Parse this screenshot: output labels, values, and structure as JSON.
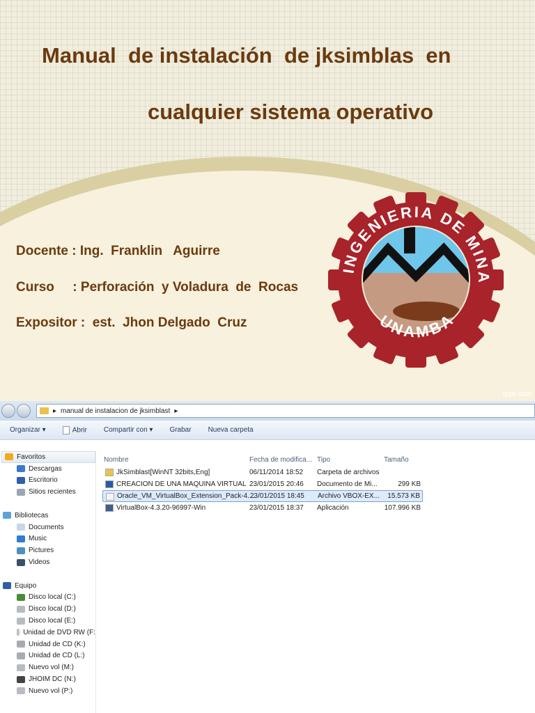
{
  "slide": {
    "title_line1": "Manual  de instalación  de jksimblas  en",
    "title_line2": "cualquier sistema operativo",
    "docente": "Docente : Ing.  Franklin   Aguirre",
    "curso": "Curso     : Perforación  y Voladura  de  Rocas",
    "expositor": "Expositor :  est.  Jhon Delgado  Cruz",
    "logo_text_top": "INGENIERIA DE MINAS",
    "logo_text_bottom": "UNAMBA",
    "watermark": "fppt.com"
  },
  "explorer": {
    "breadcrumb": "manual de instalacion de  jksimblast",
    "toolbar": {
      "organize": "Organizar ▾",
      "open": "Abrir",
      "share": "Compartir con ▾",
      "burn": "Grabar",
      "new_folder": "Nueva carpeta"
    },
    "sidebar": [
      {
        "label": "Favoritos",
        "group": true,
        "icon": "star-icon",
        "color": "#f2a91e"
      },
      {
        "label": "Descargas",
        "icon": "downloads-icon",
        "color": "#3a7ad0"
      },
      {
        "label": "Escritorio",
        "icon": "desktop-icon",
        "color": "#2f5fa8"
      },
      {
        "label": "Sitios recientes",
        "icon": "recent-icon",
        "color": "#9aa6b4"
      },
      {
        "label": "",
        "spacer": true
      },
      {
        "label": "Bibliotecas",
        "group": true,
        "icon": "libraries-icon",
        "color": "#5ba3d9"
      },
      {
        "label": "Documents",
        "icon": "documents-icon",
        "color": "#c9d6e6"
      },
      {
        "label": "Music",
        "icon": "music-icon",
        "color": "#2f7bd6"
      },
      {
        "label": "Pictures",
        "icon": "pictures-icon",
        "color": "#4e8fbf"
      },
      {
        "label": "Videos",
        "icon": "videos-icon",
        "color": "#3a4f6a"
      },
      {
        "label": "",
        "spacer": true
      },
      {
        "label": "Equipo",
        "group": true,
        "icon": "computer-icon",
        "color": "#2d5fa3"
      },
      {
        "label": "Disco local (C:)",
        "icon": "drive-c-icon",
        "color": "#4a8a3a"
      },
      {
        "label": "Disco local (D:)",
        "icon": "drive-icon",
        "color": "#b8bcc2"
      },
      {
        "label": "Disco local (E:)",
        "icon": "drive-icon",
        "color": "#b8bcc2"
      },
      {
        "label": "Unidad de DVD RW (F:",
        "icon": "dvd-icon",
        "color": "#c0c0c0"
      },
      {
        "label": "Unidad de CD (K:)",
        "icon": "cd-icon",
        "color": "#a8acb2"
      },
      {
        "label": "Unidad de CD (L:)",
        "icon": "cd-icon",
        "color": "#a8acb2"
      },
      {
        "label": "Nuevo vol (M:)",
        "icon": "drive-icon",
        "color": "#b8bcc2"
      },
      {
        "label": "JHOIM DC (N:)",
        "icon": "usb-drive-icon",
        "color": "#444"
      },
      {
        "label": "Nuevo vol (P:)",
        "icon": "drive-icon",
        "color": "#b8bcc2"
      }
    ],
    "columns": [
      "Nombre",
      "Fecha de modifica...",
      "Tipo",
      "Tamaño"
    ],
    "files": [
      {
        "name": "JkSimblast[WinNT 32bits,Eng]",
        "date": "06/11/2014 18:52",
        "type": "Carpeta de archivos",
        "size": "",
        "icon": "folder-icon",
        "color": "#e8c350"
      },
      {
        "name": "CREACION DE UNA MAQUINA VIRTUAL",
        "date": "23/01/2015 20:46",
        "type": "Documento de Mi...",
        "size": "299 KB",
        "icon": "word-doc-icon",
        "color": "#2b5aa8"
      },
      {
        "name": "Oracle_VM_VirtualBox_Extension_Pack-4....",
        "date": "23/01/2015 18:45",
        "type": "Archivo VBOX-EX...",
        "size": "15.573 KB",
        "icon": "file-icon",
        "color": "#f4f4f4",
        "selected": true
      },
      {
        "name": "VirtualBox-4.3.20-96997-Win",
        "date": "23/01/2015 18:37",
        "type": "Aplicación",
        "size": "107.996 KB",
        "icon": "virtualbox-icon",
        "color": "#3c5e94"
      }
    ]
  }
}
